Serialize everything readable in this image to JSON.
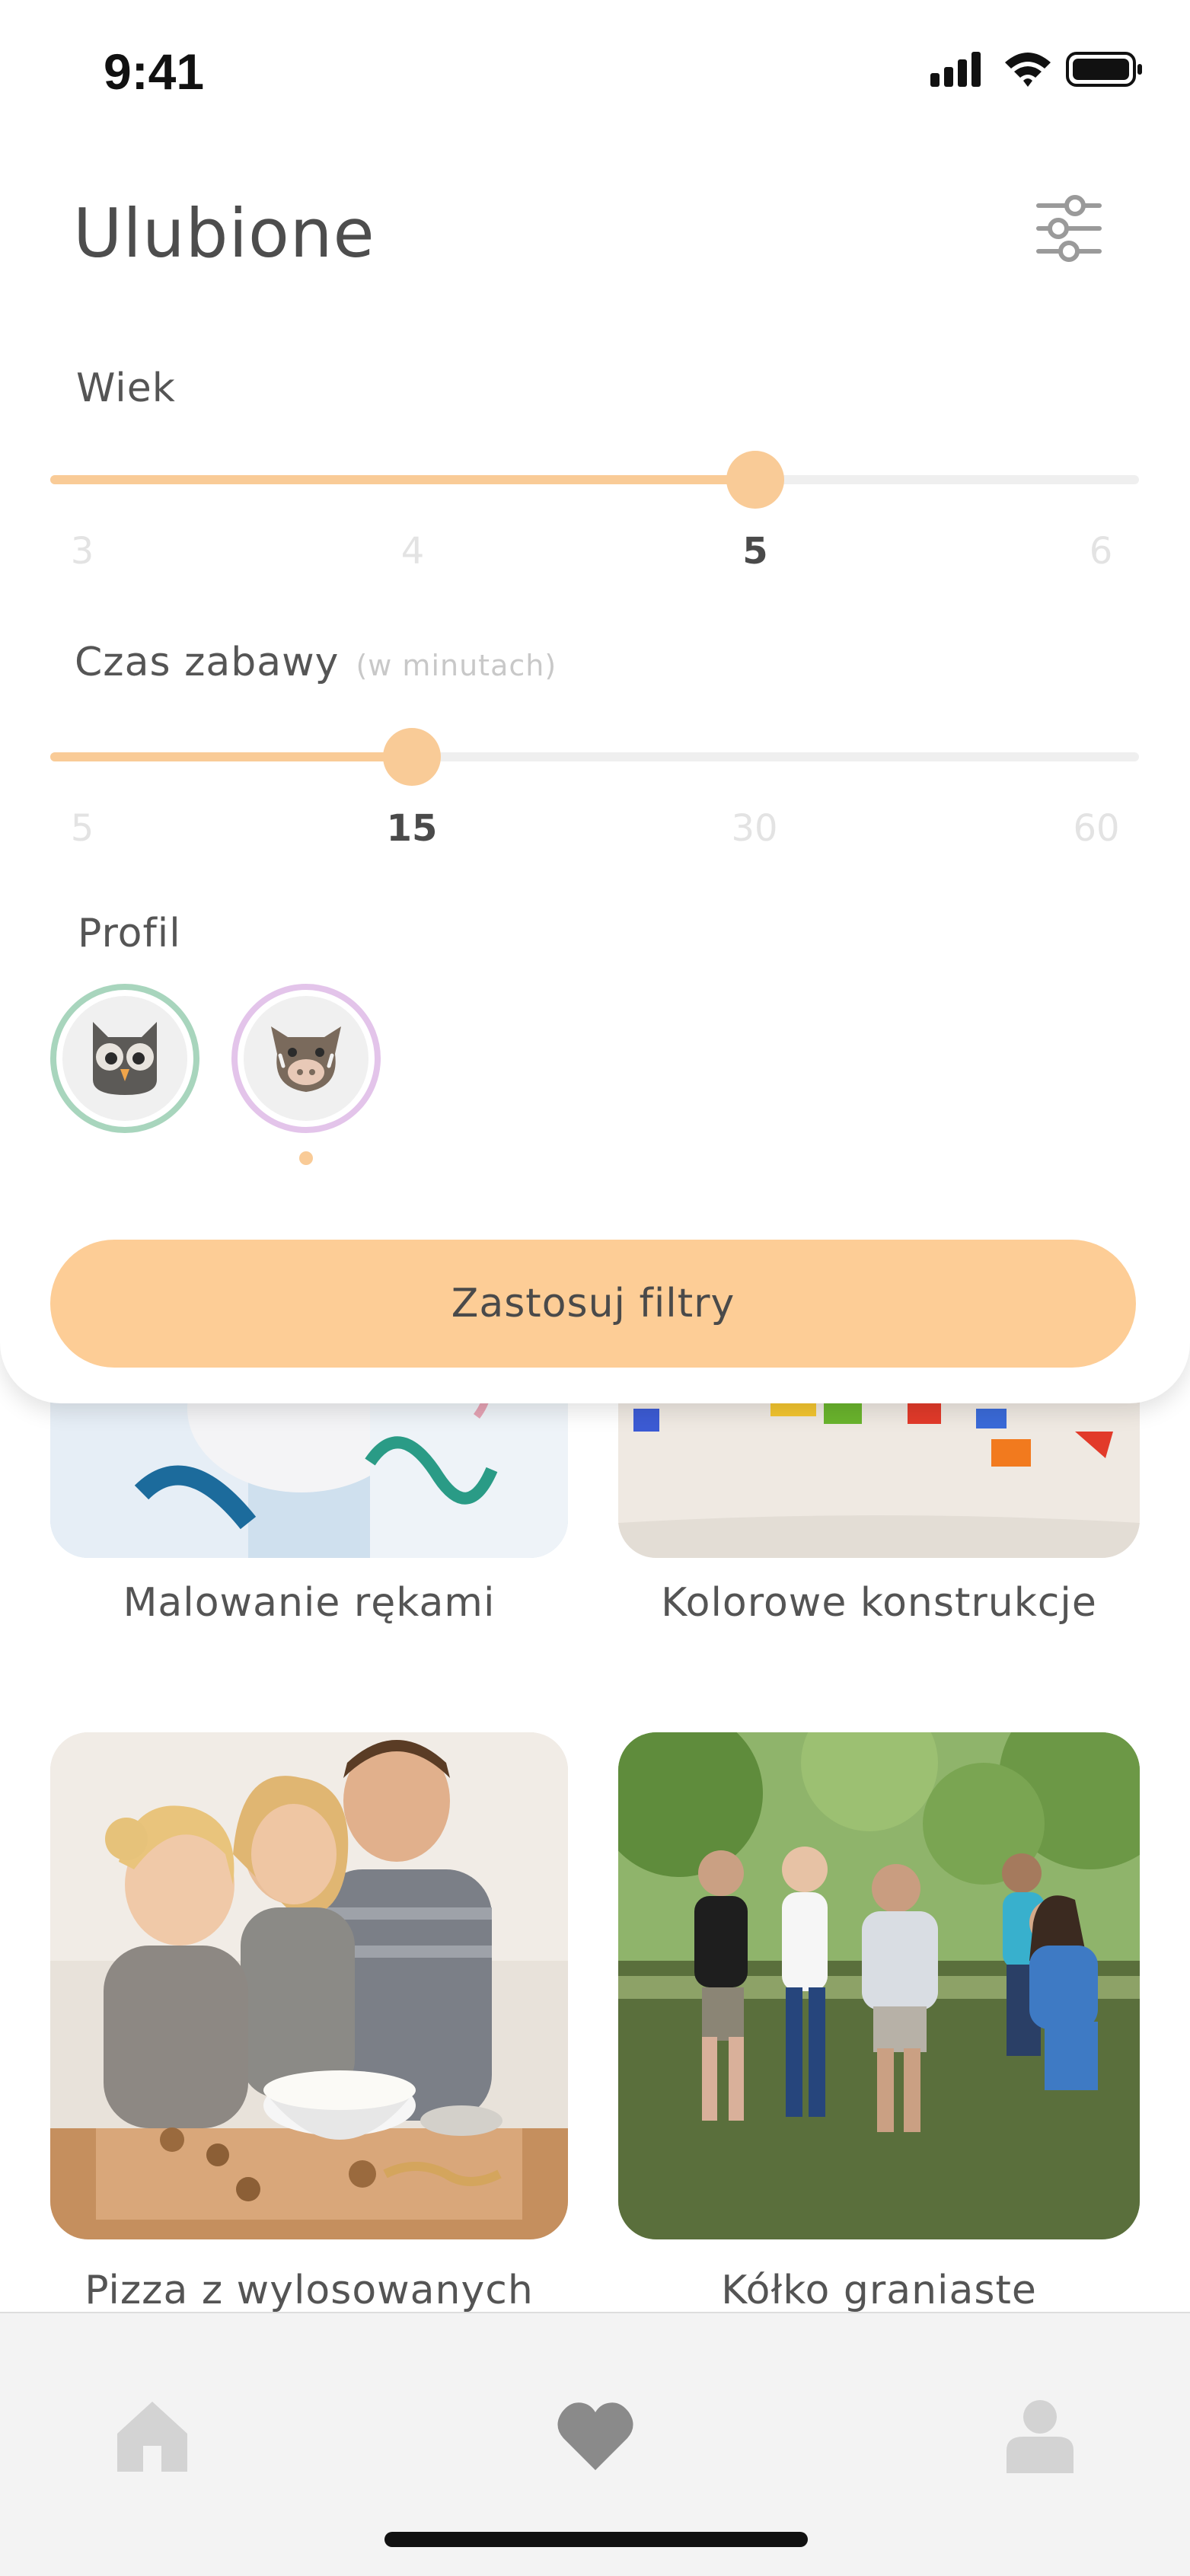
{
  "status_bar": {
    "time": "9:41"
  },
  "header": {
    "title": "Ulubione",
    "filter_icon": "sliders-icon"
  },
  "filters": {
    "age": {
      "label": "Wiek",
      "ticks": [
        "3",
        "4",
        "5",
        "6"
      ],
      "selected": "5"
    },
    "play_time": {
      "label": "Czas zabawy",
      "hint": "(w minutach)",
      "ticks": [
        "5",
        "15",
        "30",
        "60"
      ],
      "selected": "15"
    },
    "profile": {
      "label": "Profil",
      "avatars": [
        {
          "icon": "owl-icon",
          "ring_color": "#a8d5bd",
          "selected": false
        },
        {
          "icon": "boar-icon",
          "ring_color": "#e3c4ea",
          "selected": true
        }
      ]
    },
    "apply_label": "Zastosuj filtry"
  },
  "cards": [
    {
      "title": "Malowanie rękami"
    },
    {
      "title": "Kolorowe konstrukcje"
    },
    {
      "title": "Pizza z wylosowanych"
    },
    {
      "title": "Kółko graniaste"
    }
  ],
  "tabbar": {
    "tabs": [
      {
        "icon": "home-icon",
        "active": false
      },
      {
        "icon": "heart-icon",
        "active": true
      },
      {
        "icon": "profile-icon",
        "active": false
      }
    ]
  },
  "colors": {
    "accent": "#f9cb97",
    "inactive_icon": "#d3d3d3",
    "active_icon": "#8a8a8a"
  }
}
